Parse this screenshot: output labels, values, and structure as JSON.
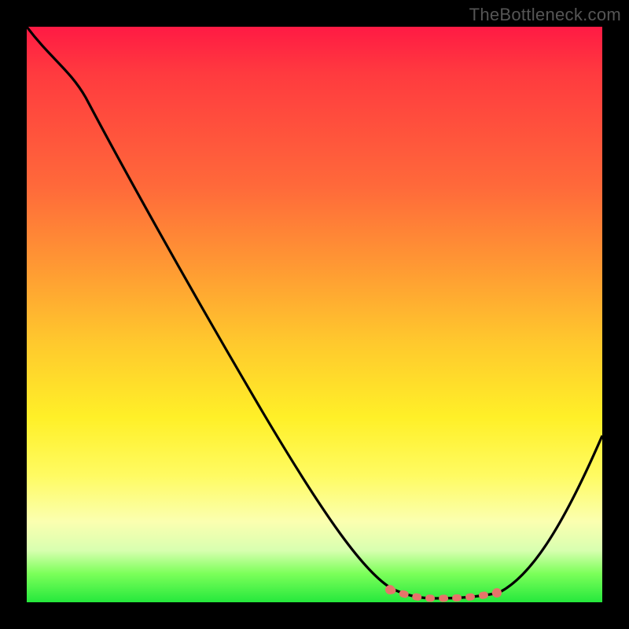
{
  "watermark": "TheBottleneck.com",
  "chart_data": {
    "type": "line",
    "title": "",
    "xlabel": "",
    "ylabel": "",
    "xlim": [
      0,
      100
    ],
    "ylim": [
      0,
      100
    ],
    "x": [
      0,
      5,
      10,
      15,
      20,
      25,
      30,
      35,
      40,
      45,
      50,
      55,
      60,
      63,
      66,
      70,
      74,
      78,
      82,
      86,
      90,
      94,
      100
    ],
    "values": [
      100,
      96,
      91,
      84,
      77,
      70,
      63,
      56,
      49,
      42,
      35,
      27,
      18,
      10,
      5,
      2,
      1,
      1,
      1,
      3,
      8,
      16,
      30
    ],
    "flat_segment": {
      "x_start": 63,
      "x_end": 82,
      "color": "#e6746a"
    },
    "gradient_stops": [
      {
        "pos": 0,
        "color": "#ff1a44"
      },
      {
        "pos": 28,
        "color": "#ff6a3a"
      },
      {
        "pos": 55,
        "color": "#ffc92d"
      },
      {
        "pos": 78,
        "color": "#fffb62"
      },
      {
        "pos": 100,
        "color": "#25e83c"
      }
    ]
  }
}
